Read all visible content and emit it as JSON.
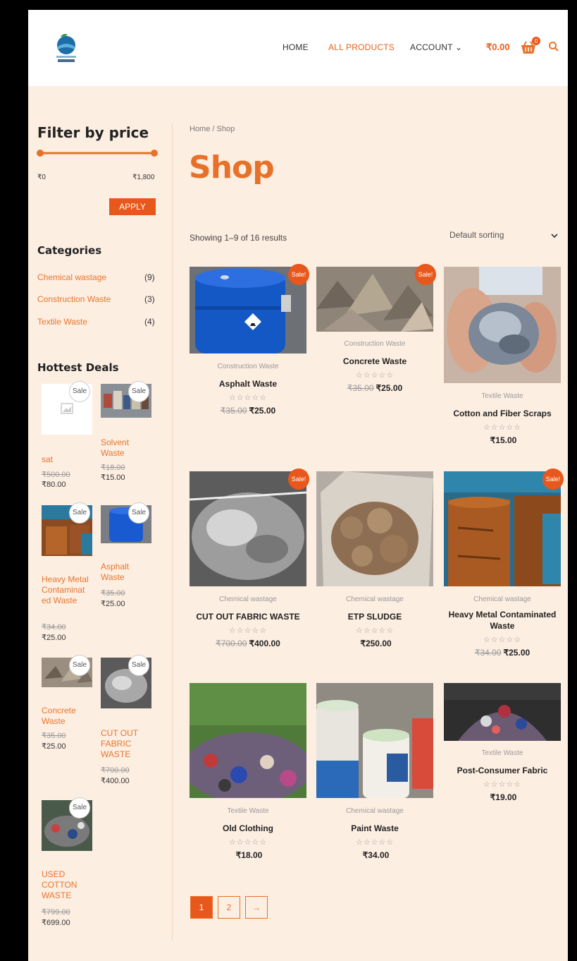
{
  "header": {
    "nav": [
      {
        "label": "HOME"
      },
      {
        "label": "ALL PRODUCTS"
      },
      {
        "label": "ACCOUNT ⌄"
      }
    ],
    "cart_total": "₹0.00",
    "cart_count": "0",
    "brand_color": "#e8712a"
  },
  "sidebar": {
    "filter_title": "Filter by price",
    "price_min": "₹0",
    "price_max": "₹1,800",
    "apply_label": "APPLY",
    "categories_title": "Categories",
    "categories": [
      {
        "name": "Chemical wastage",
        "count": "(9)"
      },
      {
        "name": "Construction Waste",
        "count": "(3)"
      },
      {
        "name": "Textile Waste",
        "count": "(4)"
      }
    ],
    "deals_title": "Hottest Deals",
    "sale_label": "Sale",
    "deals": [
      {
        "name": "sat",
        "old": "₹500.00",
        "new": "₹80.00"
      },
      {
        "name": "Solvent Waste",
        "old": "₹18.00",
        "new": "₹15.00"
      },
      {
        "name": "Heavy Metal Contaminat ed Waste",
        "old": "₹34.00",
        "new": "₹25.00"
      },
      {
        "name": "Asphalt Waste",
        "old": "₹35.00",
        "new": "₹25.00"
      },
      {
        "name": "Concrete Waste",
        "old": "₹35.00",
        "new": "₹25.00"
      },
      {
        "name": "CUT OUT FABRIC WASTE",
        "old": "₹700.00",
        "new": "₹400.00"
      },
      {
        "name": "USED COTTON WASTE",
        "old": "₹799.00",
        "new": "₹699.00"
      }
    ]
  },
  "main": {
    "breadcrumb": "Home / Shop",
    "title": "Shop",
    "result_count": "Showing 1–9 of 16 results",
    "sorting": "Default sorting",
    "sale_badge": "Sale!",
    "stars": "☆☆☆☆☆",
    "products": [
      {
        "category": "Construction Waste",
        "name": "Asphalt Waste",
        "old": "₹35.00",
        "price": "₹25.00",
        "sale": true
      },
      {
        "category": "Construction Waste",
        "name": "Concrete Waste",
        "old": "₹35.00",
        "price": "₹25.00",
        "sale": true
      },
      {
        "category": "Textile Waste",
        "name": "Cotton and Fiber Scraps",
        "old": "",
        "price": "₹15.00",
        "sale": false
      },
      {
        "category": "Chemical wastage",
        "name": "CUT OUT FABRIC WASTE",
        "old": "₹700.00",
        "price": "₹400.00",
        "sale": true
      },
      {
        "category": "Chemical wastage",
        "name": "ETP SLUDGE",
        "old": "",
        "price": "₹250.00",
        "sale": false
      },
      {
        "category": "Chemical wastage",
        "name": "Heavy Metal Contaminated Waste",
        "old": "₹34.00",
        "price": "₹25.00",
        "sale": true
      },
      {
        "category": "Textile Waste",
        "name": "Old Clothing",
        "old": "",
        "price": "₹18.00",
        "sale": false
      },
      {
        "category": "Chemical wastage",
        "name": "Paint Waste",
        "old": "",
        "price": "₹34.00",
        "sale": false
      },
      {
        "category": "Textile Waste",
        "name": "Post-Consumer Fabric",
        "old": "",
        "price": "₹19.00",
        "sale": false
      }
    ],
    "pagination": [
      "1",
      "2",
      "→"
    ]
  }
}
